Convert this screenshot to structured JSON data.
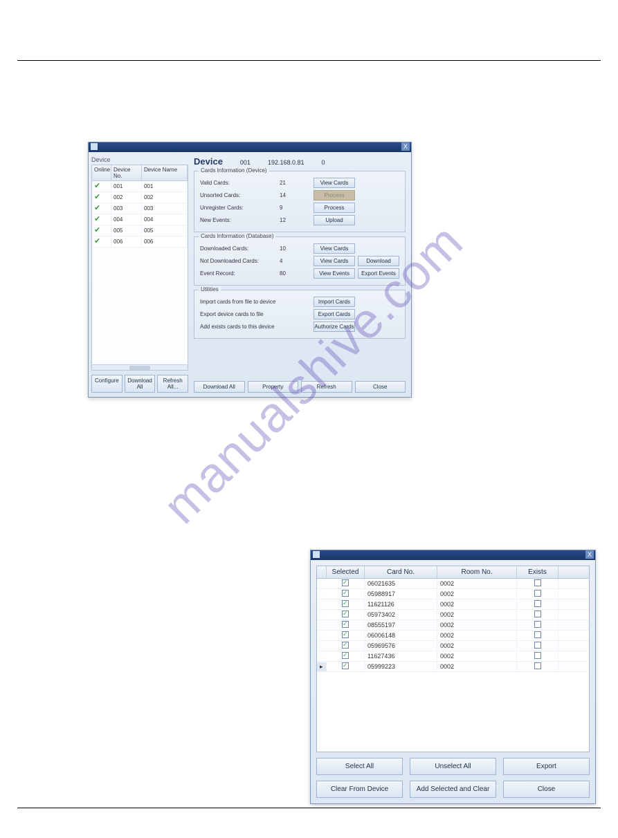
{
  "watermark": "manualshive.com",
  "dialog1": {
    "titlebar": {
      "close": "X"
    },
    "left": {
      "group_label": "Device",
      "columns": {
        "online": "Online",
        "device_no": "Device No.",
        "device_name": "Device Name"
      },
      "rows": [
        {
          "no": "001",
          "name": "001"
        },
        {
          "no": "002",
          "name": "002"
        },
        {
          "no": "003",
          "name": "003"
        },
        {
          "no": "004",
          "name": "004"
        },
        {
          "no": "005",
          "name": "005"
        },
        {
          "no": "006",
          "name": "006"
        }
      ],
      "buttons": {
        "configure": "Configure",
        "download_all": "Download All",
        "refresh_all": "Refresh All..."
      }
    },
    "header": {
      "title": "Device",
      "id": "001",
      "ip": "192.168.0.81",
      "extra": "0"
    },
    "cards_device": {
      "legend": "Cards Information (Device)",
      "rows": [
        {
          "label": "Valid Cards:",
          "value": "21",
          "btn1": "View Cards",
          "btn1_disabled": false
        },
        {
          "label": "Unsorted Cards:",
          "value": "14",
          "btn1": "Process",
          "btn1_disabled": true
        },
        {
          "label": "Unregister Cards:",
          "value": "9",
          "btn1": "Process",
          "btn1_disabled": false
        },
        {
          "label": "New Events:",
          "value": "12",
          "btn1": "Upload",
          "btn1_disabled": false
        }
      ]
    },
    "cards_db": {
      "legend": "Cards Information (Database)",
      "rows": [
        {
          "label": "Downloaded Cards:",
          "value": "10",
          "btn1": "View Cards"
        },
        {
          "label": "Not Downloaded Cards:",
          "value": "4",
          "btn1": "View Cards",
          "btn2": "Download"
        },
        {
          "label": "Event Record:",
          "value": "80",
          "btn1": "View Events",
          "btn2": "Export Events"
        }
      ]
    },
    "utilities": {
      "legend": "Utilities",
      "rows": [
        {
          "label": "Import cards from file to device",
          "btn1": "Import Cards"
        },
        {
          "label": "Export device cards to file",
          "btn1": "Export Cards"
        },
        {
          "label": "Add exists cards to this device",
          "btn1": "Authorize Cards"
        }
      ]
    },
    "bottom_buttons": {
      "download_all": "Download All",
      "property": "Property",
      "refresh": "Refresh",
      "close": "Close"
    }
  },
  "dialog2": {
    "titlebar": {
      "close": "X"
    },
    "columns": {
      "selected": "Selected",
      "card_no": "Card No.",
      "room_no": "Room No.",
      "exists": "Exists"
    },
    "rows": [
      {
        "selected": true,
        "card_no": "06021635",
        "room_no": "0002",
        "exists": false
      },
      {
        "selected": true,
        "card_no": "05988917",
        "room_no": "0002",
        "exists": false
      },
      {
        "selected": true,
        "card_no": "11621126",
        "room_no": "0002",
        "exists": false
      },
      {
        "selected": true,
        "card_no": "05973402",
        "room_no": "0002",
        "exists": false
      },
      {
        "selected": true,
        "card_no": "08555197",
        "room_no": "0002",
        "exists": false
      },
      {
        "selected": true,
        "card_no": "06006148",
        "room_no": "0002",
        "exists": false
      },
      {
        "selected": true,
        "card_no": "05969576",
        "room_no": "0002",
        "exists": false
      },
      {
        "selected": true,
        "card_no": "11627436",
        "room_no": "0002",
        "exists": false
      },
      {
        "selected": true,
        "card_no": "05999223",
        "room_no": "0002",
        "exists": false,
        "current": true
      }
    ],
    "buttons": {
      "select_all": "Select All",
      "unselect_all": "Unselect All",
      "export": "Export",
      "clear_from_device": "Clear From Device",
      "add_selected_clear": "Add Selected and Clear",
      "close": "Close"
    }
  }
}
